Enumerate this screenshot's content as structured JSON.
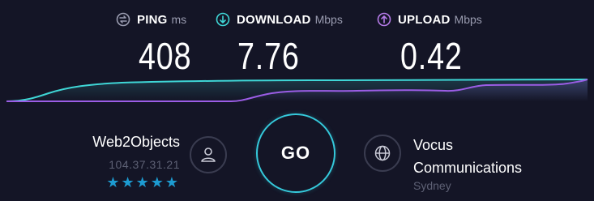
{
  "metrics": {
    "ping": {
      "label": "PING",
      "unit": "ms",
      "value": "408",
      "icon": "ping-icon",
      "color": "#9a9cb0"
    },
    "download": {
      "label": "DOWNLOAD",
      "unit": "Mbps",
      "value": "7.76",
      "icon": "download-arrow-icon",
      "color": "#3fd6d6"
    },
    "upload": {
      "label": "UPLOAD",
      "unit": "Mbps",
      "value": "0.42",
      "icon": "upload-arrow-icon",
      "color": "#b57be8"
    }
  },
  "graph": {
    "download_color": "#3fd6d6",
    "upload_color": "#9b5de5"
  },
  "host": {
    "name": "Web2Objects",
    "ip": "104.37.31.21",
    "stars": "★★★★★",
    "rating": 5,
    "icon": "user-icon"
  },
  "go_button": {
    "label": "GO",
    "color": "#35c9db"
  },
  "isp": {
    "name_line1": "Vocus",
    "name_line2": "Communications",
    "location": "Sydney",
    "icon": "globe-icon"
  },
  "colors": {
    "background": "#141526",
    "accent": "#35c9db",
    "star": "#1d9bd1",
    "muted_text": "#5e6175"
  }
}
